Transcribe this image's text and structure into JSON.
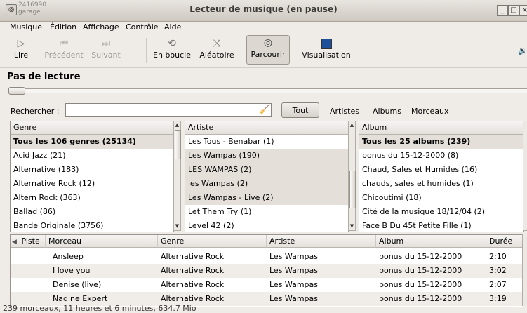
{
  "window": {
    "title": "Lecteur de musique (en pause)",
    "ghost_text_1": "2416990",
    "ghost_text_2": "garage",
    "btn_min": "_",
    "btn_max": "□",
    "btn_close": "×"
  },
  "menu": [
    "Musique",
    "Édition",
    "Affichage",
    "Contrôle",
    "Aide"
  ],
  "toolbar": {
    "play": "Lire",
    "prev": "Précédent",
    "next": "Suivant",
    "repeat": "En boucle",
    "shuffle": "Aléatoire",
    "browse": "Parcourir",
    "visualize": "Visualisation"
  },
  "player": {
    "now_playing": "Pas de lecture",
    "seek_position": 0
  },
  "search": {
    "label": "Rechercher :",
    "value": "",
    "all_button": "Tout",
    "filters": [
      "Artistes",
      "Albums",
      "Morceaux"
    ]
  },
  "genre_pane": {
    "header": "Genre",
    "rows": [
      "Tous les 106 genres (25134)",
      "Acid Jazz (21)",
      "Alternative (183)",
      "Alternative Rock (12)",
      "Altern Rock (363)",
      "Ballad (86)",
      "Bande Originale (3756)"
    ]
  },
  "artist_pane": {
    "header": "Artiste",
    "rows": [
      "Les Tous - Benabar (1)",
      "Les Wampas (190)",
      "LES WAMPAS (2)",
      "les Wampas (2)",
      "Les Wampas - Live (2)",
      "Let Them Try (1)",
      "Level 42 (2)"
    ]
  },
  "album_pane": {
    "header": "Album",
    "rows": [
      "Tous les 25 albums (239)",
      "bonus du 15-12-2000 (8)",
      "Chaud, Sales et Humides (16)",
      "chauds, sales et humides (1)",
      "Chicoutimi (18)",
      "Cité de la musique 18/12/04 (2)",
      "Face B Du 45t Petite Fille (1)"
    ]
  },
  "tracks": {
    "columns": [
      "Piste",
      "Morceau",
      "Genre",
      "Artiste",
      "Album",
      "Durée"
    ],
    "rows": [
      {
        "title": "Ansleep",
        "genre": "Alternative Rock",
        "artist": "Les Wampas",
        "album": "bonus du 15-12-2000",
        "duration": "2:10"
      },
      {
        "title": "I love you",
        "genre": "Alternative Rock",
        "artist": "Les Wampas",
        "album": "bonus du 15-12-2000",
        "duration": "3:02"
      },
      {
        "title": "Denise (live)",
        "genre": "Alternative Rock",
        "artist": "Les Wampas",
        "album": "bonus du 15-12-2000",
        "duration": "2:07"
      },
      {
        "title": "Nadine Expert",
        "genre": "Alternative Rock",
        "artist": "Les Wampas",
        "album": "bonus du 15-12-2000",
        "duration": "3:19"
      }
    ]
  },
  "statusbar": "239 morceaux, 11 heures et 6 minutes, 634.7 Mio"
}
